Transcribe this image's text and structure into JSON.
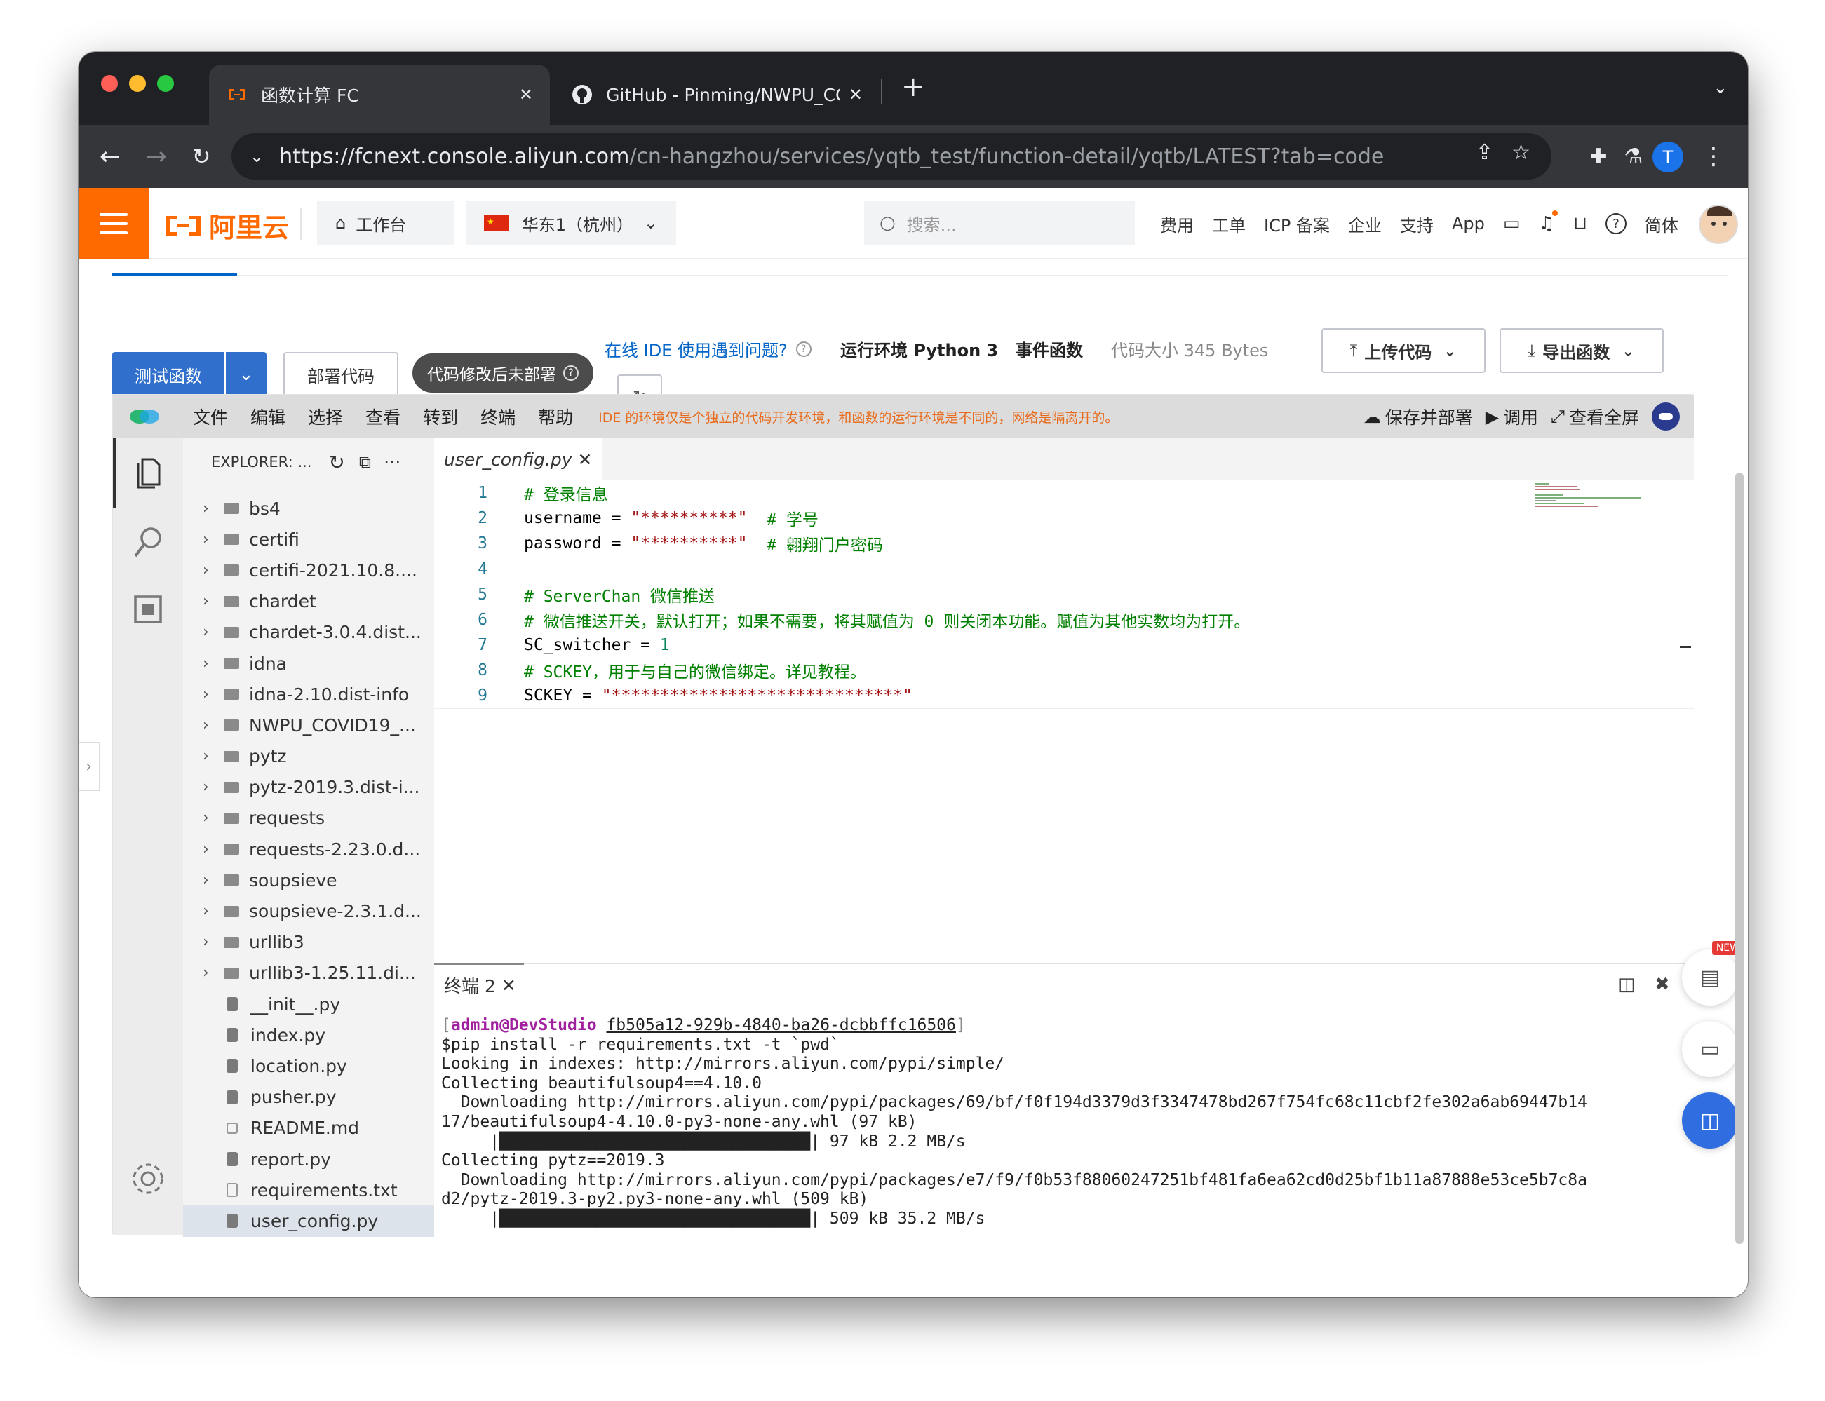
{
  "browser": {
    "tabs": [
      {
        "title": "函数计算 FC",
        "active": true
      },
      {
        "title": "GitHub - Pinming/NWPU_COVI",
        "active": false
      }
    ],
    "url_host": "https://fcnext.console.aliyun.com",
    "url_path": "/cn-hangzhou/services/yqtb_test/function-detail/yqtb/LATEST?tab=code",
    "profile_initial": "T"
  },
  "header": {
    "logo_text": "阿里云",
    "workbench": "工作台",
    "region": "华东1（杭州）",
    "search_placeholder": "搜索...",
    "links": [
      "费用",
      "工单",
      "ICP 备案",
      "企业",
      "支持",
      "App"
    ],
    "lang": "简体",
    "brand_color": "#ff6a00"
  },
  "function_bar": {
    "test_button": "测试函数",
    "deploy_button": "部署代码",
    "status_badge": "代码修改后未部署",
    "ide_help": "在线 IDE 使用遇到问题?",
    "runtime": "运行环境 Python 3",
    "type": "事件函数",
    "code_size": "代码大小 345 Bytes",
    "upload_button": "上传代码",
    "export_button": "导出函数"
  },
  "ide": {
    "menu": [
      "文件",
      "编辑",
      "选择",
      "查看",
      "转到",
      "终端",
      "帮助"
    ],
    "notice": "IDE 的环境仅是个独立的代码开发环境，和函数的运行环境是不同的，网络是隔离开的。",
    "save_deploy": "保存并部署",
    "invoke": "调用",
    "fullscreen": "查看全屏",
    "explorer_title": "EXPLORER: ...",
    "files": [
      {
        "name": "bs4",
        "kind": "folder"
      },
      {
        "name": "certifi",
        "kind": "folder"
      },
      {
        "name": "certifi-2021.10.8....",
        "kind": "folder"
      },
      {
        "name": "chardet",
        "kind": "folder"
      },
      {
        "name": "chardet-3.0.4.dist...",
        "kind": "folder"
      },
      {
        "name": "idna",
        "kind": "folder"
      },
      {
        "name": "idna-2.10.dist-info",
        "kind": "folder"
      },
      {
        "name": "NWPU_COVID19_...",
        "kind": "folder"
      },
      {
        "name": "pytz",
        "kind": "folder"
      },
      {
        "name": "pytz-2019.3.dist-i...",
        "kind": "folder"
      },
      {
        "name": "requests",
        "kind": "folder"
      },
      {
        "name": "requests-2.23.0.d...",
        "kind": "folder"
      },
      {
        "name": "soupsieve",
        "kind": "folder"
      },
      {
        "name": "soupsieve-2.3.1.d...",
        "kind": "folder"
      },
      {
        "name": "urllib3",
        "kind": "folder"
      },
      {
        "name": "urllib3-1.25.11.di...",
        "kind": "folder"
      },
      {
        "name": "__init__.py",
        "kind": "py"
      },
      {
        "name": "index.py",
        "kind": "py"
      },
      {
        "name": "location.py",
        "kind": "py"
      },
      {
        "name": "pusher.py",
        "kind": "py"
      },
      {
        "name": "README.md",
        "kind": "md"
      },
      {
        "name": "report.py",
        "kind": "py"
      },
      {
        "name": "requirements.txt",
        "kind": "txt"
      },
      {
        "name": "user_config.py",
        "kind": "py",
        "selected": true
      }
    ],
    "editor_tab": "user_config.py",
    "code_lines": [
      [
        {
          "t": "# 登录信息",
          "c": "cm"
        }
      ],
      [
        {
          "t": "username = ",
          "c": "tx"
        },
        {
          "t": "\"**********\"",
          "c": "st"
        },
        {
          "t": "  # 学号",
          "c": "cm"
        }
      ],
      [
        {
          "t": "password = ",
          "c": "tx"
        },
        {
          "t": "\"**********\"",
          "c": "st"
        },
        {
          "t": "  # 翱翔门户密码",
          "c": "cm"
        }
      ],
      [],
      [
        {
          "t": "# ServerChan 微信推送",
          "c": "cm"
        }
      ],
      [
        {
          "t": "# 微信推送开关，默认打开；如果不需要，将其赋值为 0 则关闭本功能。赋值为其他实数均为打开。",
          "c": "cm"
        }
      ],
      [
        {
          "t": "SC_switcher = ",
          "c": "tx"
        },
        {
          "t": "1",
          "c": "nm"
        }
      ],
      [
        {
          "t": "# SCKEY，用于与自己的微信绑定。详见教程。",
          "c": "cm"
        }
      ],
      [
        {
          "t": "SCKEY = ",
          "c": "tx"
        },
        {
          "t": "\"******************************\"",
          "c": "st"
        }
      ]
    ],
    "terminal_tab": "终端 2",
    "terminal_prompt_user": "admin@DevStudio",
    "terminal_prompt_id": "fb505a12-929b-4840-ba26-dcbbffc16506",
    "terminal_lines": [
      "$pip install -r requirements.txt -t `pwd`",
      "Looking in indexes: http://mirrors.aliyun.com/pypi/simple/",
      "Collecting beautifulsoup4==4.10.0",
      "  Downloading http://mirrors.aliyun.com/pypi/packages/69/bf/f0f194d3379d3f3347478bd267f754fc68c11cbf2fe302a6ab69447b14",
      "17/beautifulsoup4-4.10.0-py3-none-any.whl (97 kB)",
      "     |████████████████████████████████| 97 kB 2.2 MB/s",
      "Collecting pytz==2019.3",
      "  Downloading http://mirrors.aliyun.com/pypi/packages/e7/f9/f0b53f88060247251bf481fa6ea62cd0d25bf1b11a87888e53ce5b7c8a",
      "d2/pytz-2019.3-py2.py3-none-any.whl (509 kB)",
      "     |████████████████████████████████| 509 kB 35.2 MB/s"
    ]
  },
  "floating": {
    "new_badge": "NEW"
  }
}
